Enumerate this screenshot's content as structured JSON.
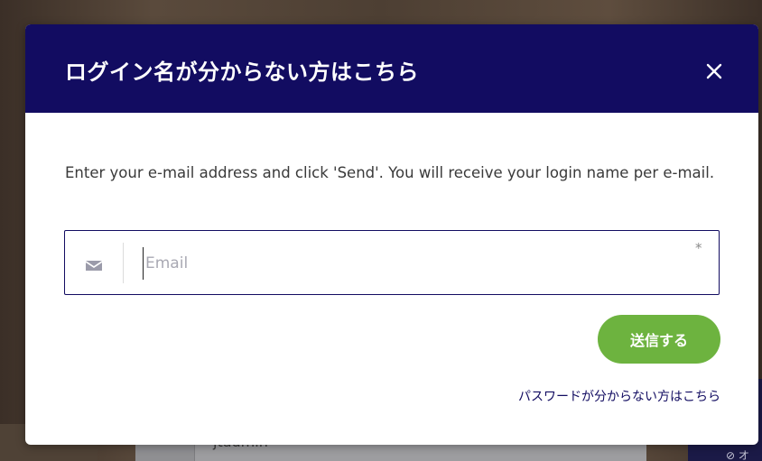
{
  "modal": {
    "title": "ログイン名が分からない方はこちら",
    "close_icon": "close-icon",
    "description": "Enter your e-mail address and click 'Send'. You will receive your login name per e-mail.",
    "email_field": {
      "icon": "envelope-icon",
      "placeholder": "Email",
      "value": "",
      "required_mark": "*"
    },
    "send_button_label": "送信する",
    "forgot_password_link": "パスワードが分からない方はこちら"
  },
  "background": {
    "card_text": "jtadmin",
    "side_text": "⊘ オ"
  },
  "colors": {
    "header": "#120c61",
    "accent_button": "#6db33f",
    "link": "#120c61"
  }
}
